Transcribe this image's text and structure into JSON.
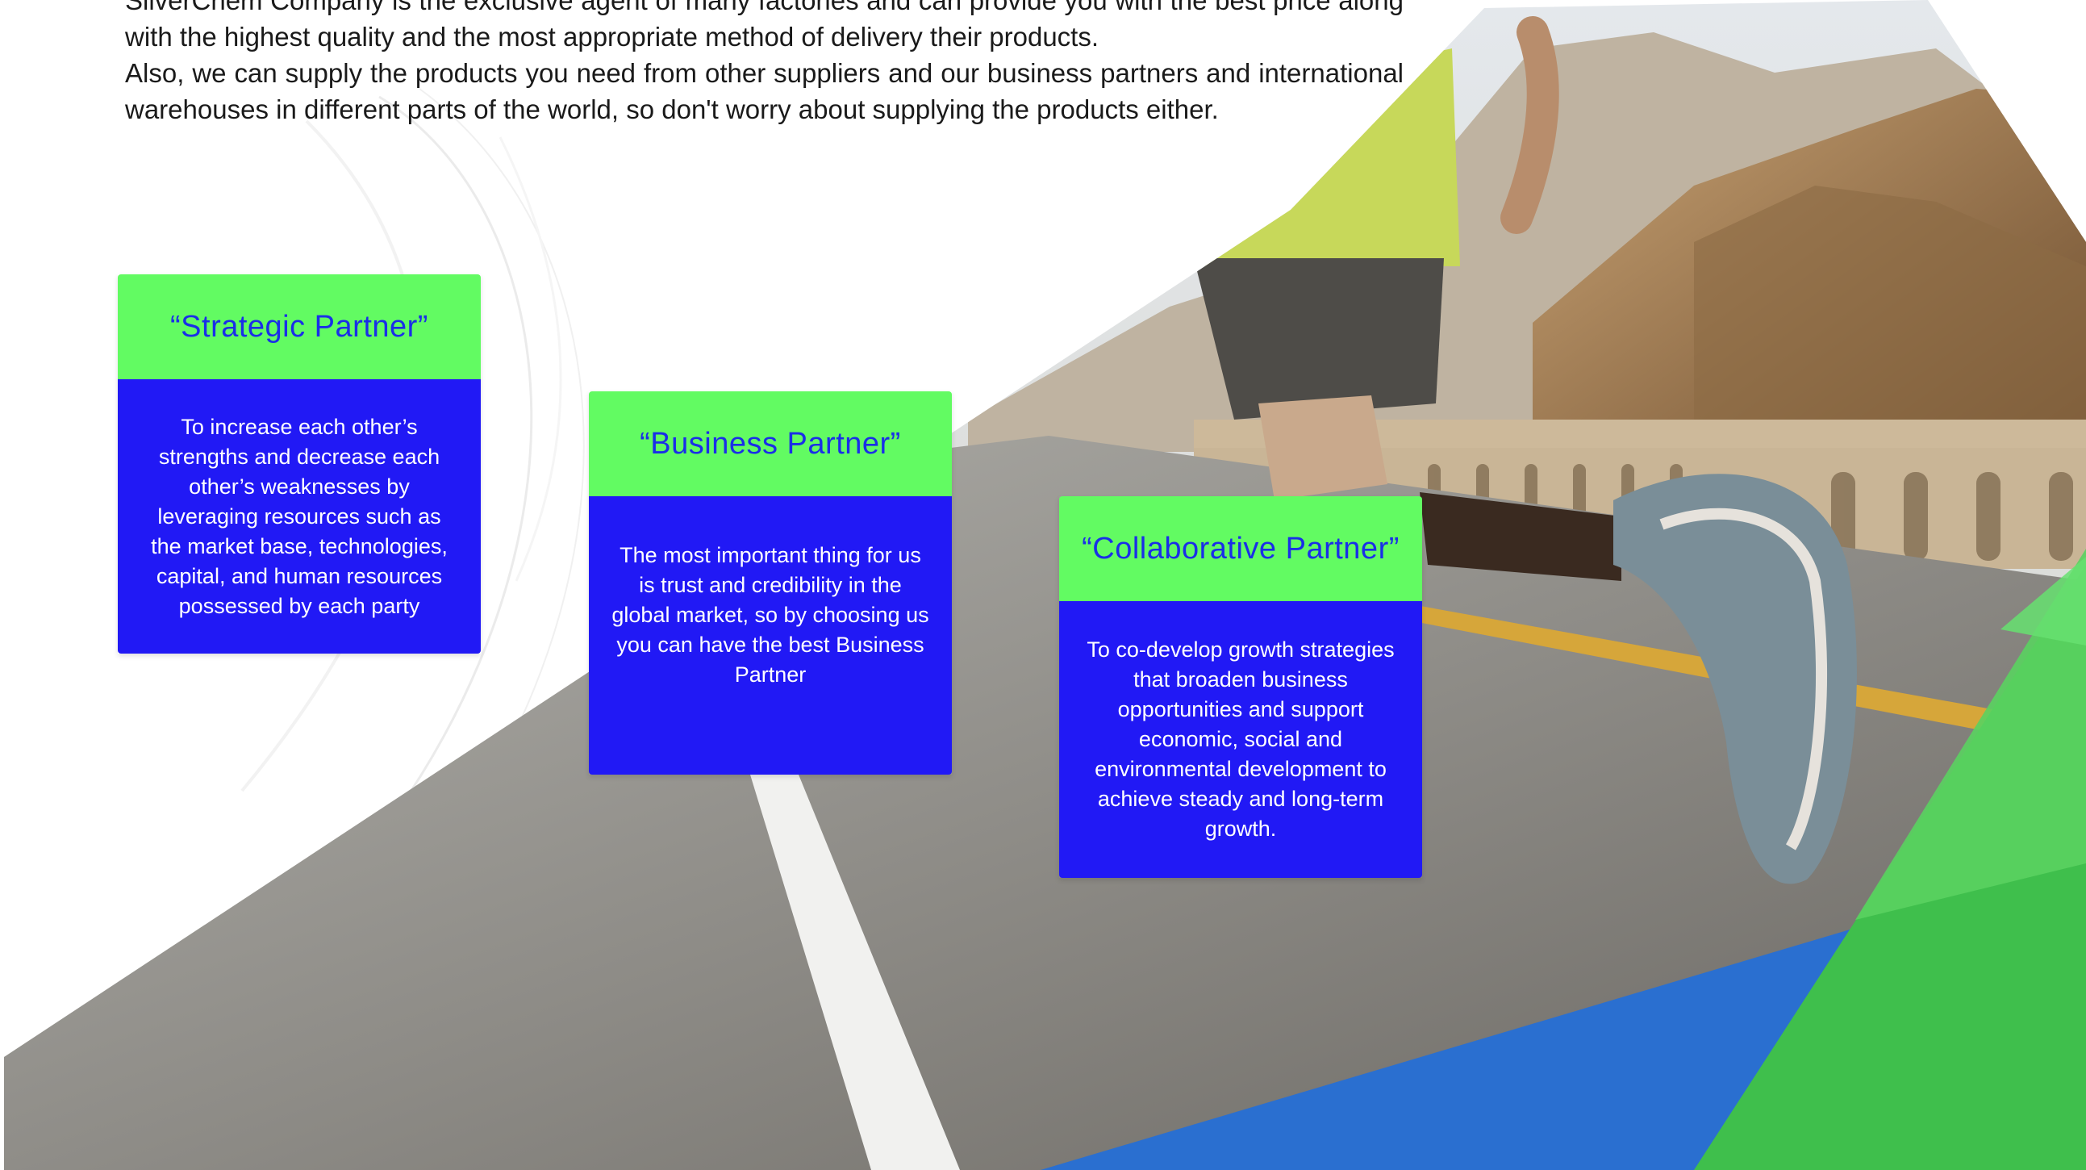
{
  "intro": {
    "line_top": "SilverChem Company is the exclusive agent of many factories and can provide you with the best price along with the highest quality and the most appropriate method of delivery their products.",
    "line_bottom": "Also, we can supply the products you need from other suppliers and our business partners and international warehouses in different parts of the world, so don't worry about supplying the products either."
  },
  "cards": [
    {
      "title": "“Strategic Partner”",
      "body": "To increase each other’s strengths and decrease each other’s weaknesses by leveraging resources such as the market base, technologies, capital, and human resources possessed by each party"
    },
    {
      "title": "“Business Partner”",
      "body": "The most important thing for us is trust and credibility in the global market, so by choosing us you can have the best Business Partner"
    },
    {
      "title": "“Collaborative Partner”",
      "body": "To co-develop growth strategies that broaden business opportunities and support economic, social and environmental development to achieve steady and long-term growth."
    }
  ],
  "colors": {
    "card_header": "#62fb62",
    "card_body": "#2119f5",
    "card_title_text": "#1a2ee8",
    "accent_green": "#4ec95a",
    "accent_blue": "#2a6fd0"
  }
}
